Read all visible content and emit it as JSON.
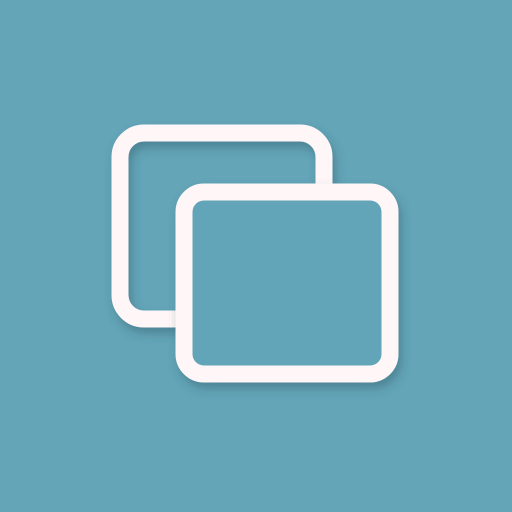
{
  "icon": {
    "name": "overlapping-windows-icon",
    "background_color": "#64A5B8",
    "stroke_color": "#FFF6F7",
    "shadow_color": "#2E5A68"
  }
}
